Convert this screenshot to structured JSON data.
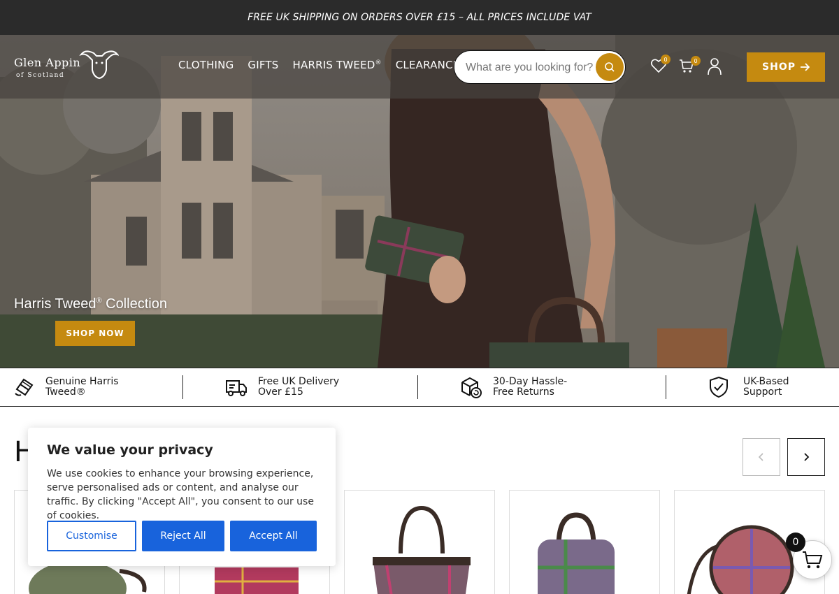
{
  "announcement": "FREE UK SHIPPING ON ORDERS OVER £15 – ALL PRICES INCLUDE VAT",
  "logo": {
    "line1": "Glen Appin",
    "line2": "of Scotland"
  },
  "nav": [
    {
      "label": "CLOTHING"
    },
    {
      "label": "GIFTS"
    },
    {
      "label": "HARRIS TWEED",
      "sup": "®"
    },
    {
      "label": "CLEARANCE"
    }
  ],
  "search": {
    "placeholder": "What are you looking for?"
  },
  "header": {
    "wishlist_count": "0",
    "cart_count": "0",
    "shop_label": "SHOP"
  },
  "hero": {
    "title": "Harris Tweed",
    "title_sup": "®",
    "title_suffix": " Collection",
    "cta": "SHOP NOW"
  },
  "usp": [
    {
      "icon": "tweed-badge-icon",
      "line1": "Genuine Harris",
      "line2": "Tweed®"
    },
    {
      "icon": "delivery-truck-icon",
      "line1": "Free UK Delivery",
      "line2": "Over £15"
    },
    {
      "icon": "returns-box-icon",
      "line1": "30-Day Hassle-",
      "line2": "Free Returns"
    },
    {
      "icon": "shield-check-icon",
      "line1": "UK-Based",
      "line2": "Support"
    }
  ],
  "section": {
    "title_visible": "H"
  },
  "cookie": {
    "title": "We value your privacy",
    "body": "We use cookies to enhance your browsing experience, serve personalised ads or content, and analyse our traffic. By clicking \"Accept All\", you consent to our use of cookies.",
    "customise": "Customise",
    "reject": "Reject All",
    "accept": "Accept All"
  },
  "floating_cart": {
    "count": "0"
  },
  "colors": {
    "accent": "#c58a10",
    "cookie_blue": "#1863dc",
    "announce_bg": "#2b2b2b"
  }
}
